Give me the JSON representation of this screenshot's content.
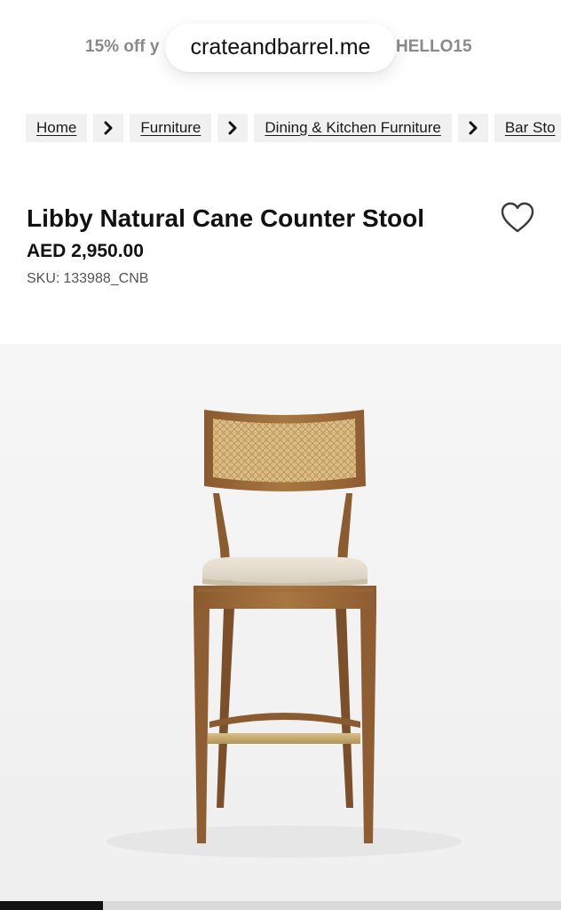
{
  "promo": {
    "text_left": "15% off y",
    "text_right": "HELLO15"
  },
  "browser": {
    "url": "crateandbarrel.me"
  },
  "breadcrumb": {
    "items": [
      {
        "label": "Home"
      },
      {
        "label": "Furniture"
      },
      {
        "label": "Dining & Kitchen Furniture"
      },
      {
        "label": "Bar Sto"
      }
    ]
  },
  "product": {
    "title": "Libby Natural Cane Counter Stool",
    "price": "AED 2,950.00",
    "sku_label": "SKU:",
    "sku_value": "133988_CNB",
    "favorite_icon": "heart-outline-icon"
  },
  "gallery": {
    "progress": 0.184
  },
  "colors": {
    "promo_text": "#8a8a8a",
    "text_primary": "#111111",
    "breadcrumb_bg": "#f1f1f1",
    "hero_bg": "#f4f4f4",
    "progress_fill": "#111111",
    "progress_track": "#d9d9d9"
  }
}
